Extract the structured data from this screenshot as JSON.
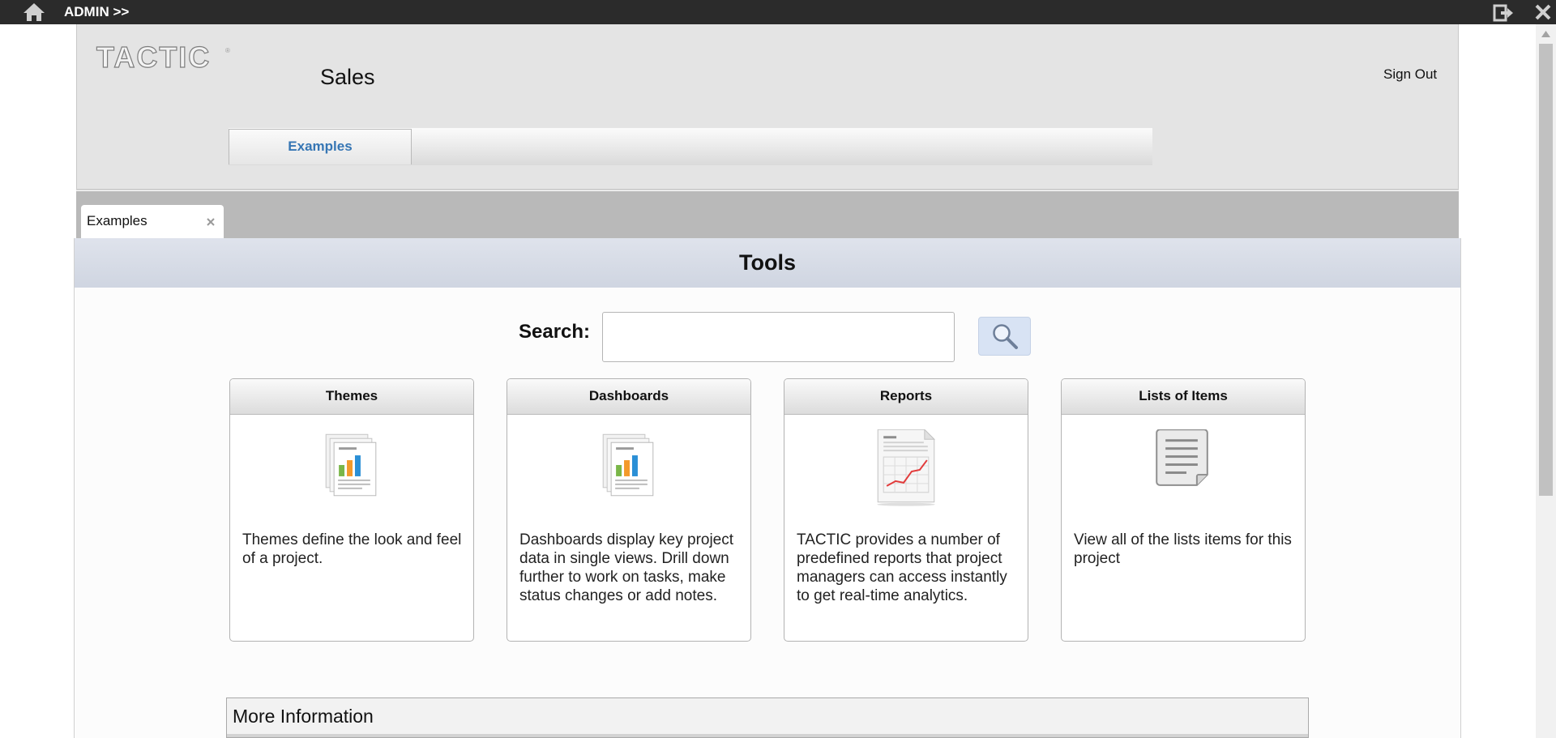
{
  "topbar": {
    "admin_label": "ADMIN >>"
  },
  "header": {
    "logo_text": "TACTIC",
    "logo_reg": "®",
    "project_title": "Sales",
    "sign_out_label": "Sign Out",
    "main_tab_label": "Examples"
  },
  "tabs": {
    "active_tab_label": "Examples"
  },
  "tools": {
    "title": "Tools",
    "search_label": "Search:",
    "search_value": ""
  },
  "cards": [
    {
      "title": "Themes",
      "icon": "themes-chart-icon",
      "description": "Themes define the look and feel of a project."
    },
    {
      "title": "Dashboards",
      "icon": "dashboards-chart-icon",
      "description": "Dashboards display key project data in single views. Drill down further to work on tasks, make status changes or add notes."
    },
    {
      "title": "Reports",
      "icon": "report-document-icon",
      "description": "TACTIC provides a number of predefined reports that project managers can access instantly to get real-time analytics."
    },
    {
      "title": "Lists of Items",
      "icon": "list-document-icon",
      "description": "View all of the lists items for this project"
    }
  ],
  "more_info": {
    "title": "More Information"
  },
  "colors": {
    "topbar": "#2b2b2b",
    "tab_link": "#3676b4",
    "tools_band": "#d8dde8"
  }
}
